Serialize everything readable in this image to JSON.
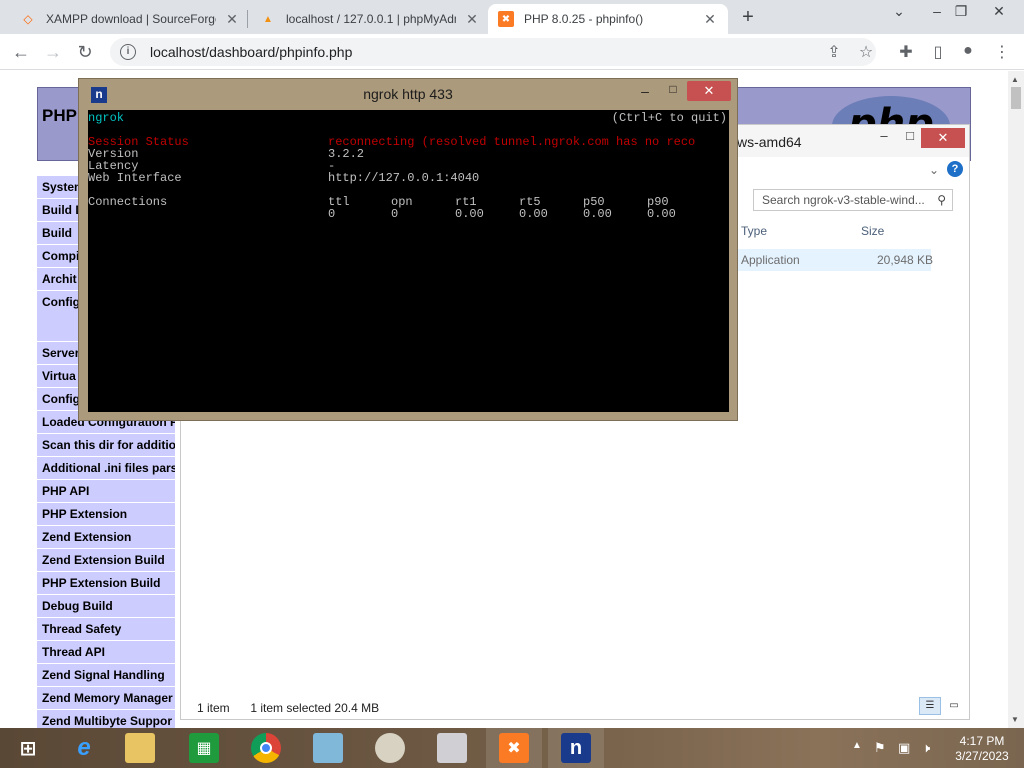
{
  "browser": {
    "tabs": [
      {
        "title": "XAMPP download | SourceForge",
        "favicon": "sourceforge-icon"
      },
      {
        "title": "localhost / 127.0.0.1 | phpMyAdm",
        "favicon": "phpmyadmin-icon"
      },
      {
        "title": "PHP 8.0.25 - phpinfo()",
        "favicon": "xampp-icon"
      }
    ],
    "new_tab": "+",
    "url": "localhost/dashboard/phpinfo.php"
  },
  "phpinfo": {
    "header": "PHP",
    "logo": "php",
    "sidebar": [
      "System",
      "Build D",
      "Build",
      "Compi",
      "Archit",
      "Config",
      "Server",
      "Virtua",
      "Config",
      "Loaded Configuration F",
      "Scan this dir for additio",
      "Additional .ini files pars",
      "PHP API",
      "PHP Extension",
      "Zend Extension",
      "Zend Extension Build",
      "PHP Extension Build",
      "Debug Build",
      "Thread Safety",
      "Thread API",
      "Zend Signal Handling",
      "Zend Memory Manager",
      "Zend Multibyte Suppor"
    ]
  },
  "explorer": {
    "title": "ws-amd64",
    "search_placeholder": "Search ngrok-v3-stable-wind...",
    "columns": {
      "type": "Type",
      "size": "Size"
    },
    "row": {
      "type": "Application",
      "size": "20,948 KB"
    },
    "status": {
      "count": "1 item",
      "selected": "1 item selected  20.4 MB"
    }
  },
  "console": {
    "title": "ngrok  http 433",
    "brand": "ngrok",
    "quit_hint": "(Ctrl+C to quit)",
    "session_label": "Session Status",
    "session_value": "reconnecting (resolved tunnel.ngrok.com has no reco",
    "version_label": "Version",
    "version_value": "3.2.2",
    "latency_label": "Latency",
    "latency_value": "-",
    "web_label": "Web Interface",
    "web_value": "http://127.0.0.1:4040",
    "connections_label": "Connections",
    "conn_headers": [
      "ttl",
      "opn",
      "rt1",
      "rt5",
      "p50",
      "p90"
    ],
    "conn_values": [
      "0",
      "0",
      "0.00",
      "0.00",
      "0.00",
      "0.00"
    ]
  },
  "taskbar": {
    "items": [
      "start-icon",
      "internet-explorer-icon",
      "file-explorer-icon",
      "store-icon",
      "chrome-icon",
      "notepad-icon",
      "paint-icon",
      "monitor-icon",
      "xampp-icon",
      "ngrok-icon"
    ],
    "time": "4:17 PM",
    "date": "3/27/2023"
  },
  "colors": {
    "php_header": "#9999cc",
    "php_sidebar": "#ccccff",
    "console_frame": "#ab9a7b",
    "console_cyan": "#00c4c4",
    "console_red": "#c00000"
  }
}
